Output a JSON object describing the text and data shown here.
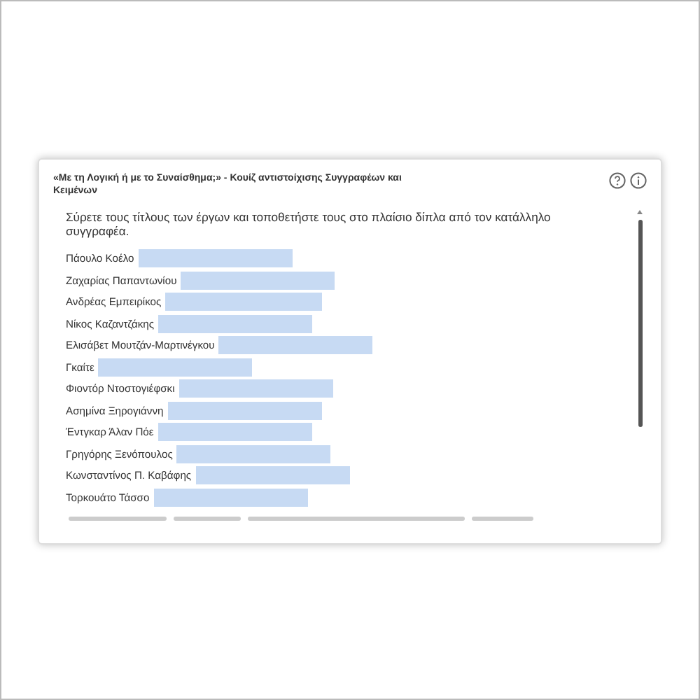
{
  "quiz": {
    "title": "«Με τη Λογική ή με το Συναίσθημα;» - Κουίζ αντιστοίχισης Συγγραφέων και Κειμένων",
    "instructions": "Σύρετε τους τίτλους των έργων και τοποθετήστε τους στο πλαίσιο δίπλα από τον κατάλληλο συγγραφέα.",
    "authors": [
      {
        "name": "Πάουλο Κοέλο"
      },
      {
        "name": "Ζαχαρίας Παπαντωνίου"
      },
      {
        "name": "Ανδρέας Εμπειρίκος"
      },
      {
        "name": "Νίκος Καζαντζάκης"
      },
      {
        "name": "Ελισάβετ Μουτζάν-Μαρτινέγκου"
      },
      {
        "name": "Γκαίτε"
      },
      {
        "name": "Φιοντόρ Ντοστογιέφσκι"
      },
      {
        "name": "Ασημίνα Ξηρογιάννη"
      },
      {
        "name": "Έντγκαρ Άλαν Πόε"
      },
      {
        "name": "Γρηγόρης Ξενόπουλος"
      },
      {
        "name": "Κωνσταντίνος Π. Καβάφης"
      },
      {
        "name": "Τορκουάτο Τάσσο"
      }
    ]
  }
}
